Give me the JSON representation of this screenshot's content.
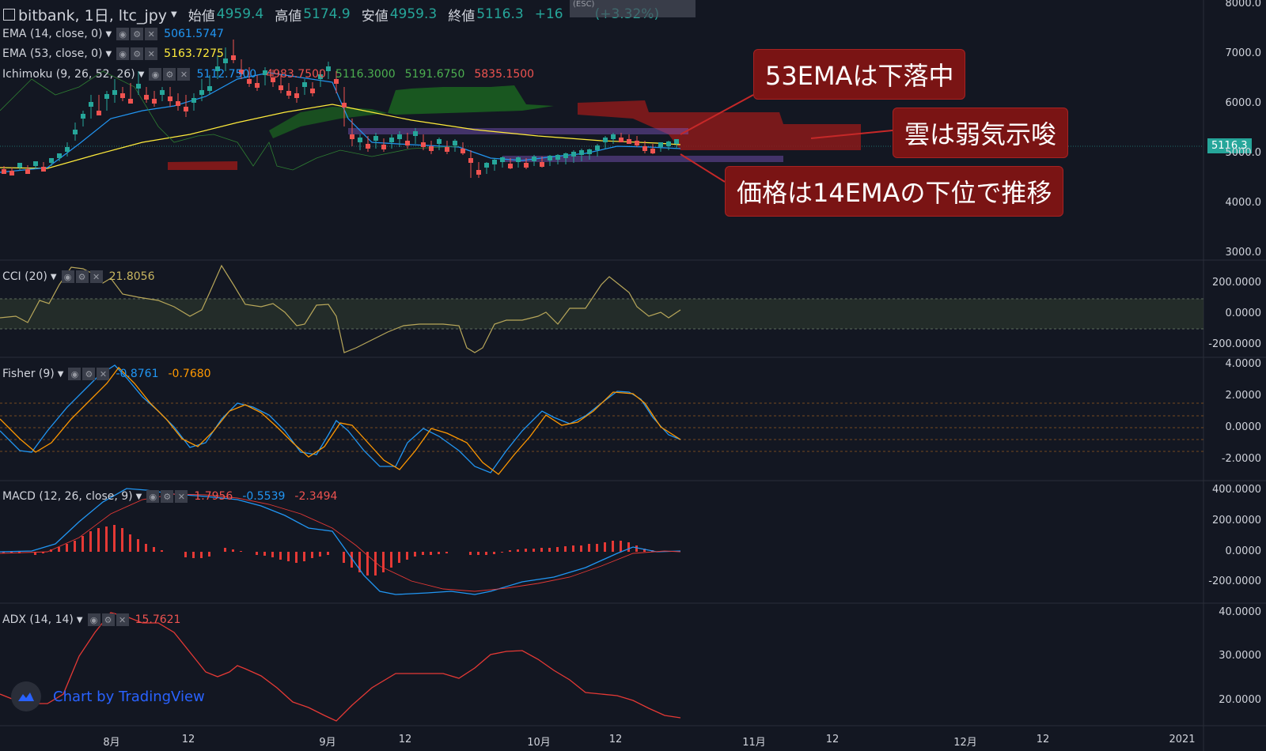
{
  "header": {
    "symbol": "bitbank, 1日, ltc_jpy",
    "open_label": "始値",
    "open": "4959.4",
    "high_label": "高値",
    "high": "5174.9",
    "low_label": "安値",
    "low": "4959.3",
    "close_label": "終値",
    "close": "5116.3",
    "change": "+16",
    "change_pct": "(+3.32%)",
    "esc": "(ESC)"
  },
  "indicators": {
    "ema14": {
      "label": "EMA (14, close, 0)",
      "value": "5061.5747",
      "color": "#2196f3"
    },
    "ema53": {
      "label": "EMA (53, close, 0)",
      "value": "5163.7275",
      "color": "#ffeb3b"
    },
    "ichimoku": {
      "label": "Ichimoku (9, 26, 52, 26)",
      "v1": "5112.7500",
      "v2": "4983.7500",
      "v3": "5116.3000",
      "v4": "5191.6750",
      "v5": "5835.1500"
    },
    "cci": {
      "label": "CCI (20)",
      "value": "21.8056"
    },
    "fisher": {
      "label": "Fisher (9)",
      "v1": "-0.8761",
      "v2": "-0.7680"
    },
    "macd": {
      "label": "MACD (12, 26, close, 9)",
      "v1": "1.7956",
      "v2": "-0.5539",
      "v3": "-2.3494"
    },
    "adx": {
      "label": "ADX (14, 14)",
      "value": "15.7621"
    }
  },
  "callouts": {
    "c1": "53EMAは下落中",
    "c2": "雲は弱気示唆",
    "c3": "価格は14EMAの下位で推移"
  },
  "price_tag": "5116.3",
  "branding": "Chart by TradingView",
  "y_axes": {
    "price": [
      "8000.0",
      "7000.0",
      "6000.0",
      "5000.0",
      "4000.0",
      "3000.0"
    ],
    "cci": [
      "200.0000",
      "0.0000",
      "-200.0000"
    ],
    "fisher": [
      "4.0000",
      "2.0000",
      "0.0000",
      "-2.0000"
    ],
    "macd": [
      "400.0000",
      "200.0000",
      "0.0000",
      "-200.0000"
    ],
    "adx": [
      "40.0000",
      "30.0000",
      "20.0000"
    ]
  },
  "x_axis": [
    "8月",
    "12",
    "9月",
    "12",
    "10月",
    "12",
    "11月",
    "12",
    "12月",
    "12",
    "2021"
  ],
  "colors": {
    "background": "#131722",
    "up": "#26a69a",
    "down": "#ef5350",
    "callout": "#7a1414"
  }
}
